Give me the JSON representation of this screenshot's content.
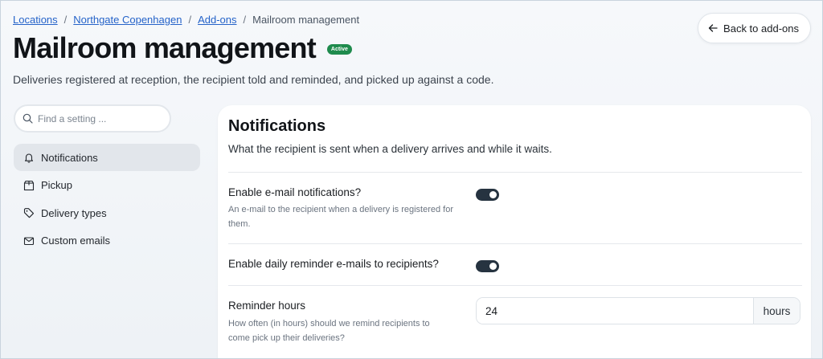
{
  "breadcrumb": {
    "items": [
      {
        "label": "Locations",
        "link": true
      },
      {
        "label": "Northgate Copenhagen",
        "link": true
      },
      {
        "label": "Add-ons",
        "link": true
      },
      {
        "label": "Mailroom management",
        "link": false
      }
    ],
    "separator": "/"
  },
  "header": {
    "title": "Mailroom management",
    "status_badge": "Active",
    "subtitle": "Deliveries registered at reception, the recipient told and reminded, and picked up against a code.",
    "back_button": {
      "label": "Back to add-ons",
      "icon": "arrow-left-icon"
    }
  },
  "sidebar": {
    "search": {
      "placeholder": "Find a setting ...",
      "value": "",
      "icon": "search-icon"
    },
    "items": [
      {
        "label": "Notifications",
        "icon": "bell-icon",
        "active": true
      },
      {
        "label": "Pickup",
        "icon": "box-icon",
        "active": false
      },
      {
        "label": "Delivery types",
        "icon": "tag-icon",
        "active": false
      },
      {
        "label": "Custom emails",
        "icon": "mail-icon",
        "active": false
      }
    ]
  },
  "panel": {
    "title": "Notifications",
    "description": "What the recipient is sent when a delivery arrives and while it waits.",
    "settings": [
      {
        "label": "Enable e-mail notifications?",
        "help": "An e-mail to the recipient when a delivery is registered for them.",
        "type": "toggle",
        "enabled": true
      },
      {
        "label": "Enable daily reminder e-mails to recipients?",
        "help": "",
        "type": "toggle",
        "enabled": true
      },
      {
        "label": "Reminder hours",
        "help": "How often (in hours) should we remind recipients to come pick up their deliveries?",
        "type": "number",
        "value": "24",
        "suffix": "hours"
      }
    ]
  },
  "colors": {
    "link": "#2563c9",
    "badge": "#1f8b4d",
    "toggle_on": "#263340"
  }
}
